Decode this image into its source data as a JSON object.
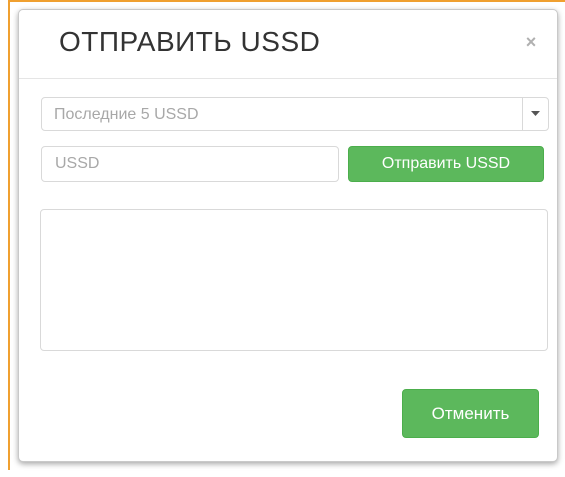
{
  "dialog": {
    "title": "ОТПРАВИТЬ USSD",
    "close_symbol": "×"
  },
  "history_select": {
    "selected": "Последние 5 USSD"
  },
  "ussd_input": {
    "placeholder": "USSD",
    "value": ""
  },
  "send_button": {
    "label": "Отправить USSD"
  },
  "output": {
    "value": ""
  },
  "cancel_button": {
    "label": "Отменить"
  },
  "colors": {
    "accent_green": "#5cb85c",
    "edge_orange": "#f0a030"
  },
  "icons": {
    "close": "close-icon",
    "dropdown": "chevron-down-icon"
  }
}
